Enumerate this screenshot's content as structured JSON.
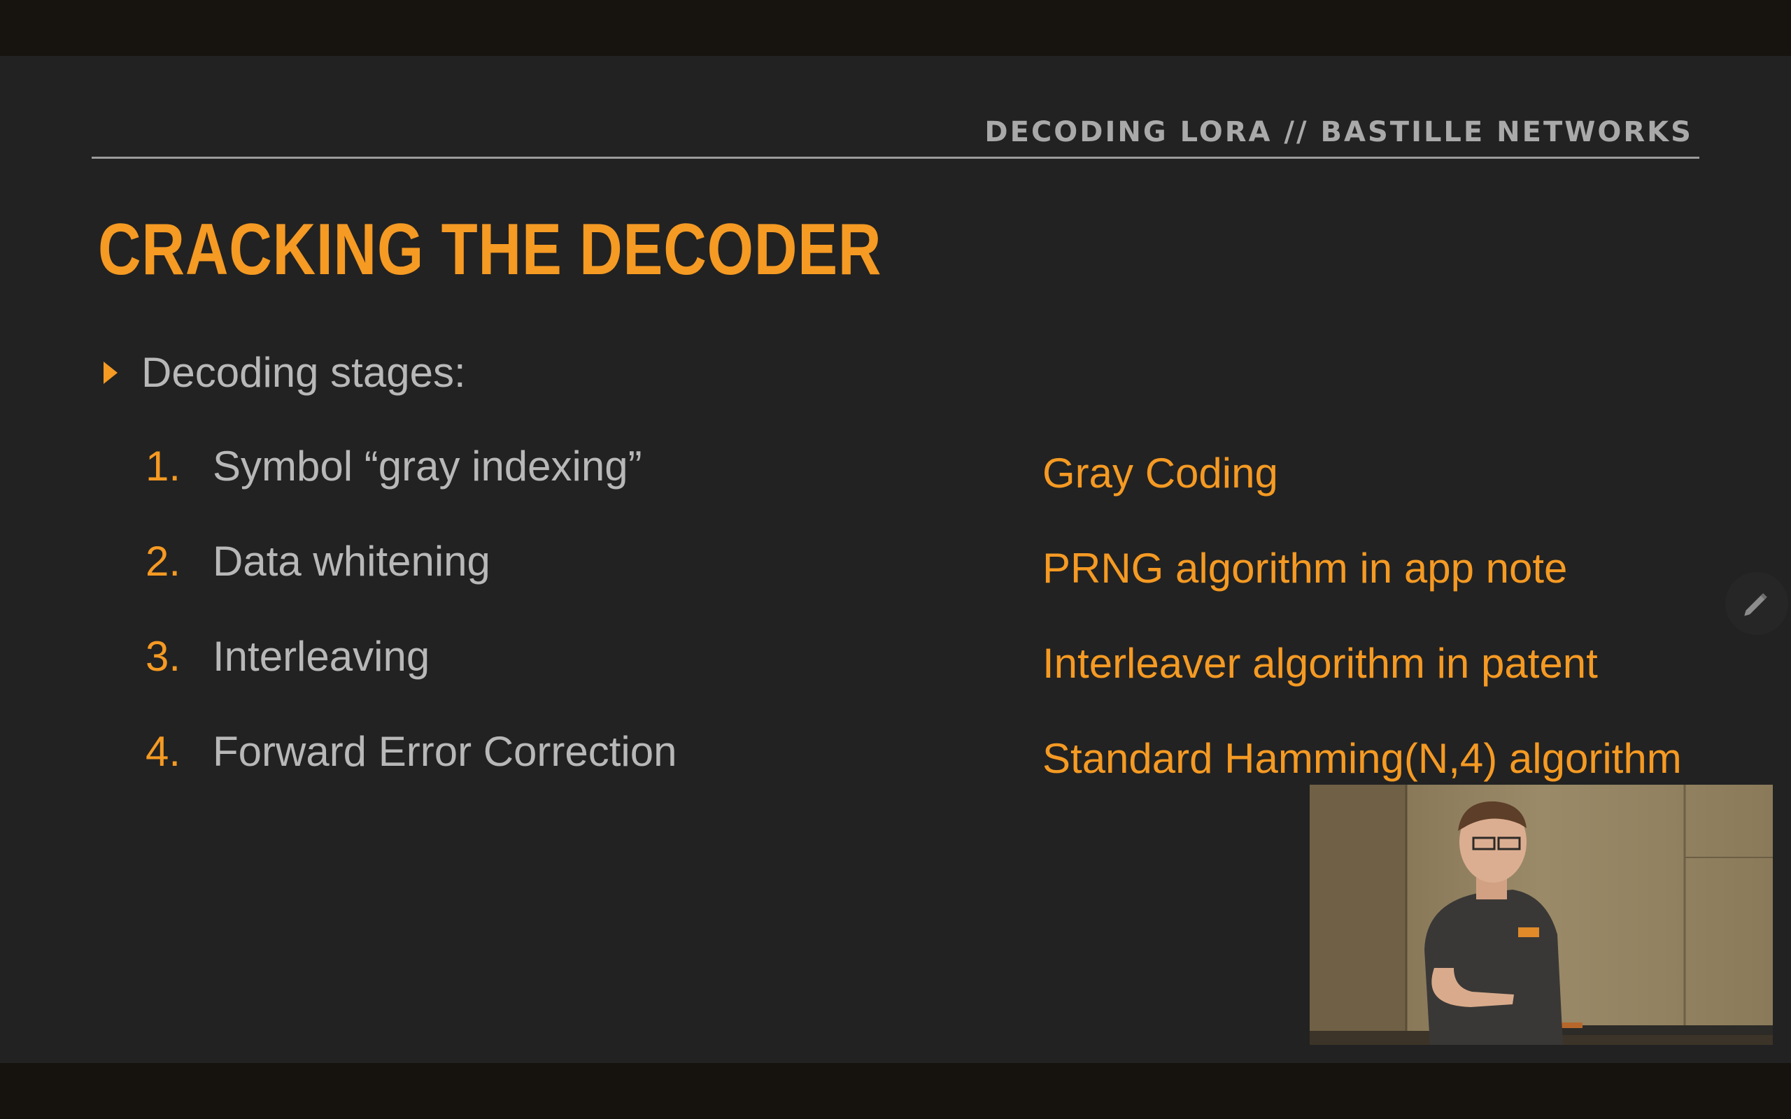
{
  "slide": {
    "header": "DECODING LORA // BASTILLE NETWORKS",
    "title": "CRACKING THE DECODER",
    "bullet": "Decoding stages:",
    "stages": [
      {
        "num": "1.",
        "text": "Symbol “gray indexing”"
      },
      {
        "num": "2.",
        "text": "Data whitening"
      },
      {
        "num": "3.",
        "text": "Interleaving"
      },
      {
        "num": "4.",
        "text": "Forward Error Correction"
      }
    ],
    "notes": [
      "Gray Coding",
      "PRNG algorithm in app note",
      "Interleaver algorithm in patent",
      "Standard Hamming(N,4) algorithm"
    ],
    "accent_color": "#f59a23"
  },
  "icons": {
    "bullet": "triangle-right-icon",
    "annotate": "pencil-icon"
  }
}
